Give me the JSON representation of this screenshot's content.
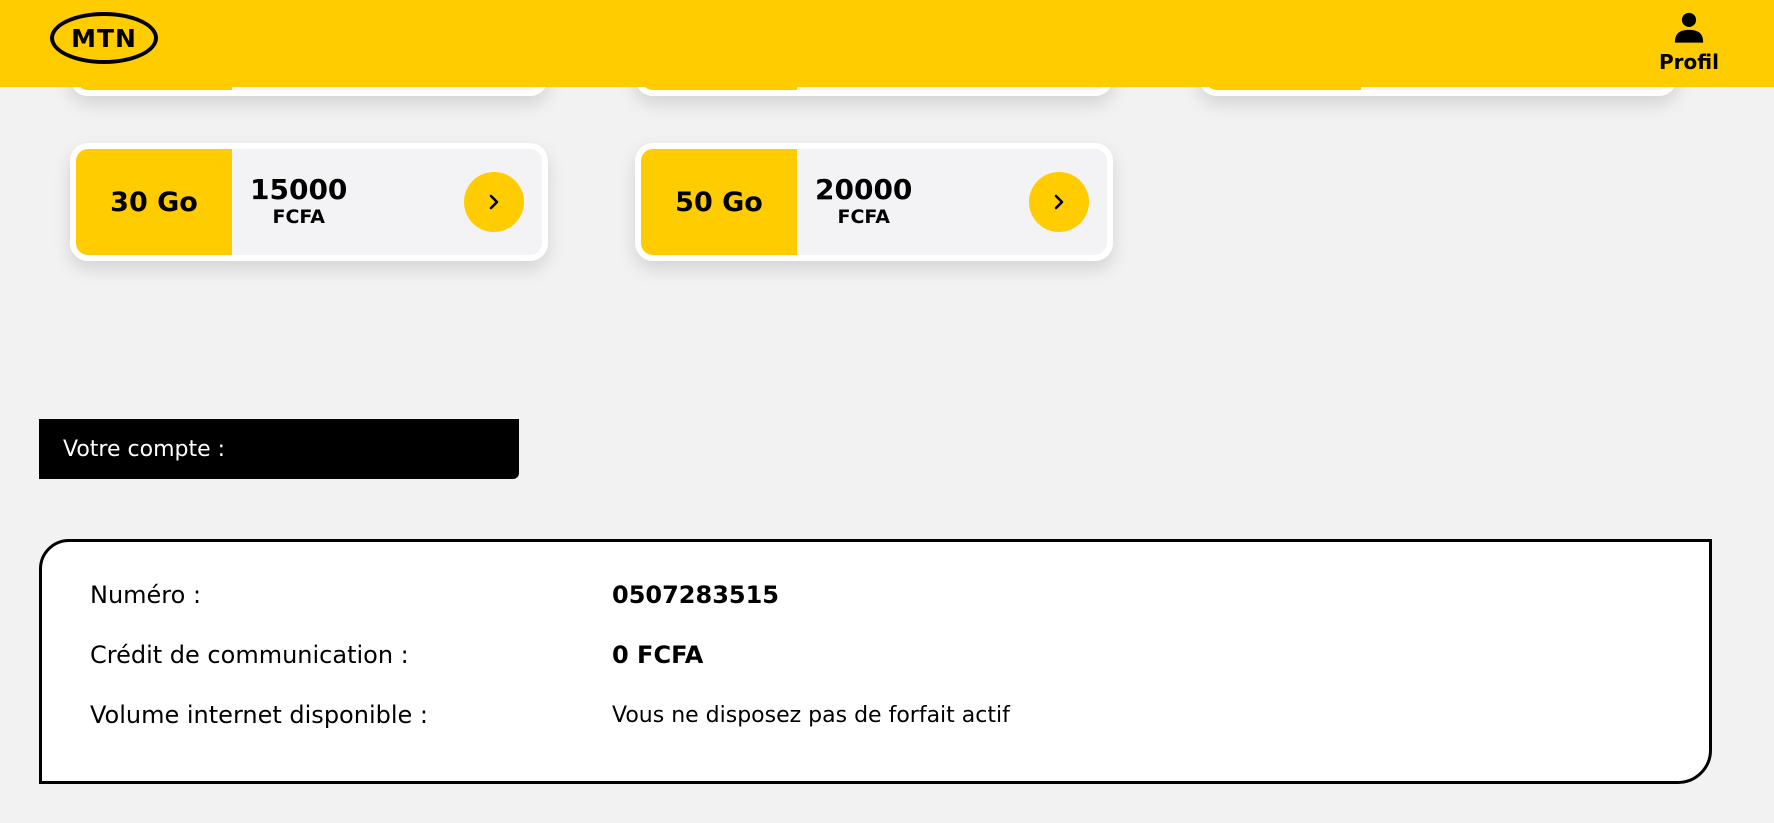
{
  "header": {
    "logo_text": "MTN",
    "profile_label": "Profil",
    "profile_icon": "person-icon"
  },
  "offers": [
    {
      "volume": "30 Go",
      "price": "15000",
      "currency": "FCFA"
    },
    {
      "volume": "50 Go",
      "price": "20000",
      "currency": "FCFA"
    }
  ],
  "account": {
    "title": "Votre compte :",
    "rows": [
      {
        "label": "Numéro :",
        "value": "0507283515"
      },
      {
        "label": "Crédit de communication :",
        "value": "0 FCFA"
      },
      {
        "label": "Volume internet disponible :",
        "value": "Vous ne disposez pas de forfait actif"
      }
    ]
  },
  "colors": {
    "brand_yellow": "#ffcc00",
    "background": "#f2f2f2",
    "card_background": "#f3f3f5",
    "black": "#000000"
  }
}
